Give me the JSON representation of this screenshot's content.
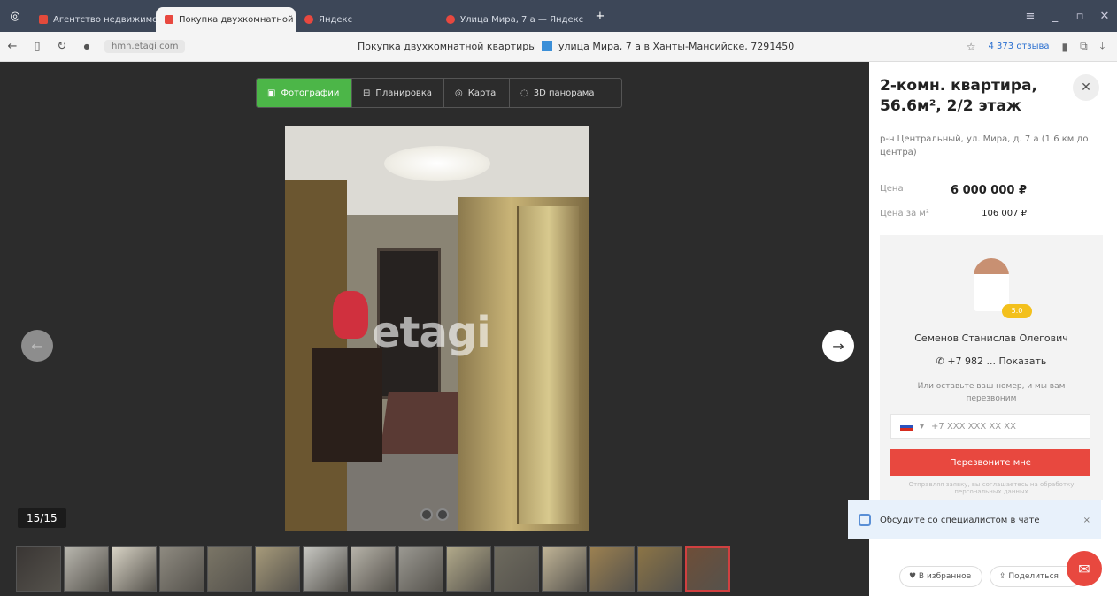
{
  "browser": {
    "tabs": [
      {
        "label": "Агентство недвижимости",
        "color": "#e34a3b"
      },
      {
        "label": "Покупка двухкомнатной",
        "color": "#e8483f"
      },
      {
        "label": "Яндекс",
        "color": "#e8483f"
      },
      {
        "label": "Улица Мира, 7 а — Яндекс",
        "color": "#e8483f"
      }
    ],
    "host": "hmn.etagi.com",
    "page_title_a": "Покупка двухкомнатной квартиры",
    "page_title_b": "улица Мира, 7 а в Ханты-Мансийске, 7291450",
    "reviews_link": "4 373 отзыва",
    "nav": {
      "back": "←",
      "reader": "▯",
      "reload": "↻",
      "secure": "●",
      "add_tab": "+",
      "minimize": "_",
      "maximize": "▫",
      "close": "✕",
      "download": "⤓",
      "extensions": "✓",
      "bookmark": "☆",
      "bookmarks": "▮",
      "screenshot": "⧉",
      "menu": "≡"
    }
  },
  "gallery": {
    "view_tabs": [
      {
        "icon": "▣",
        "label": "Фотографии"
      },
      {
        "icon": "⊟",
        "label": "Планировка"
      },
      {
        "icon": "◎",
        "label": "Карта"
      },
      {
        "icon": "◌",
        "label": "3D панорама"
      }
    ],
    "watermark": "etagi",
    "counter": "15/15",
    "arrow_left": "←",
    "arrow_right": "→",
    "thumbnail_colors": [
      "#3a3634",
      "#b8b6ae",
      "#d7d2c4",
      "#8e8a80",
      "#7a7566",
      "#a69a7a",
      "#c7c7c2",
      "#b6b2a8",
      "#9a9891",
      "#b1a98a",
      "#6d6a5e",
      "#c0b496",
      "#9b8050",
      "#8b7446",
      "#6e4e38"
    ],
    "active_thumbnail": 14
  },
  "listing": {
    "title": "2-комн. квартира, 56.6м², 2/2 этаж",
    "close": "✕",
    "address": "р-н Центральный, ул. Мира, д. 7 а (1.6 км до центра)",
    "price_label": "Цена",
    "price_value": "6 000 000 ₽",
    "ppm_label": "Цена за м²",
    "ppm_value": "106 007 ₽",
    "agent": {
      "name": "Семенов Станислав Олегович",
      "phone": "+7 982 ... Показать",
      "phone_icon": "✆",
      "rating": "5.0",
      "note": "Или оставьте ваш номер, и мы вам перезвоним",
      "country_code": "▾",
      "phone_placeholder": "+7 XXX XXX XX XX",
      "submit": "Перезвоните мне",
      "disclaimer": "Отправляя заявку, вы соглашаетесь на обработку персональных данных"
    },
    "chat_popup": "Обсудите со специалистом в чате",
    "chat_close": "×",
    "favorite_btn": "♥ В избранное",
    "share_btn": "⇪ Поделиться",
    "chat_fab": "✉"
  }
}
